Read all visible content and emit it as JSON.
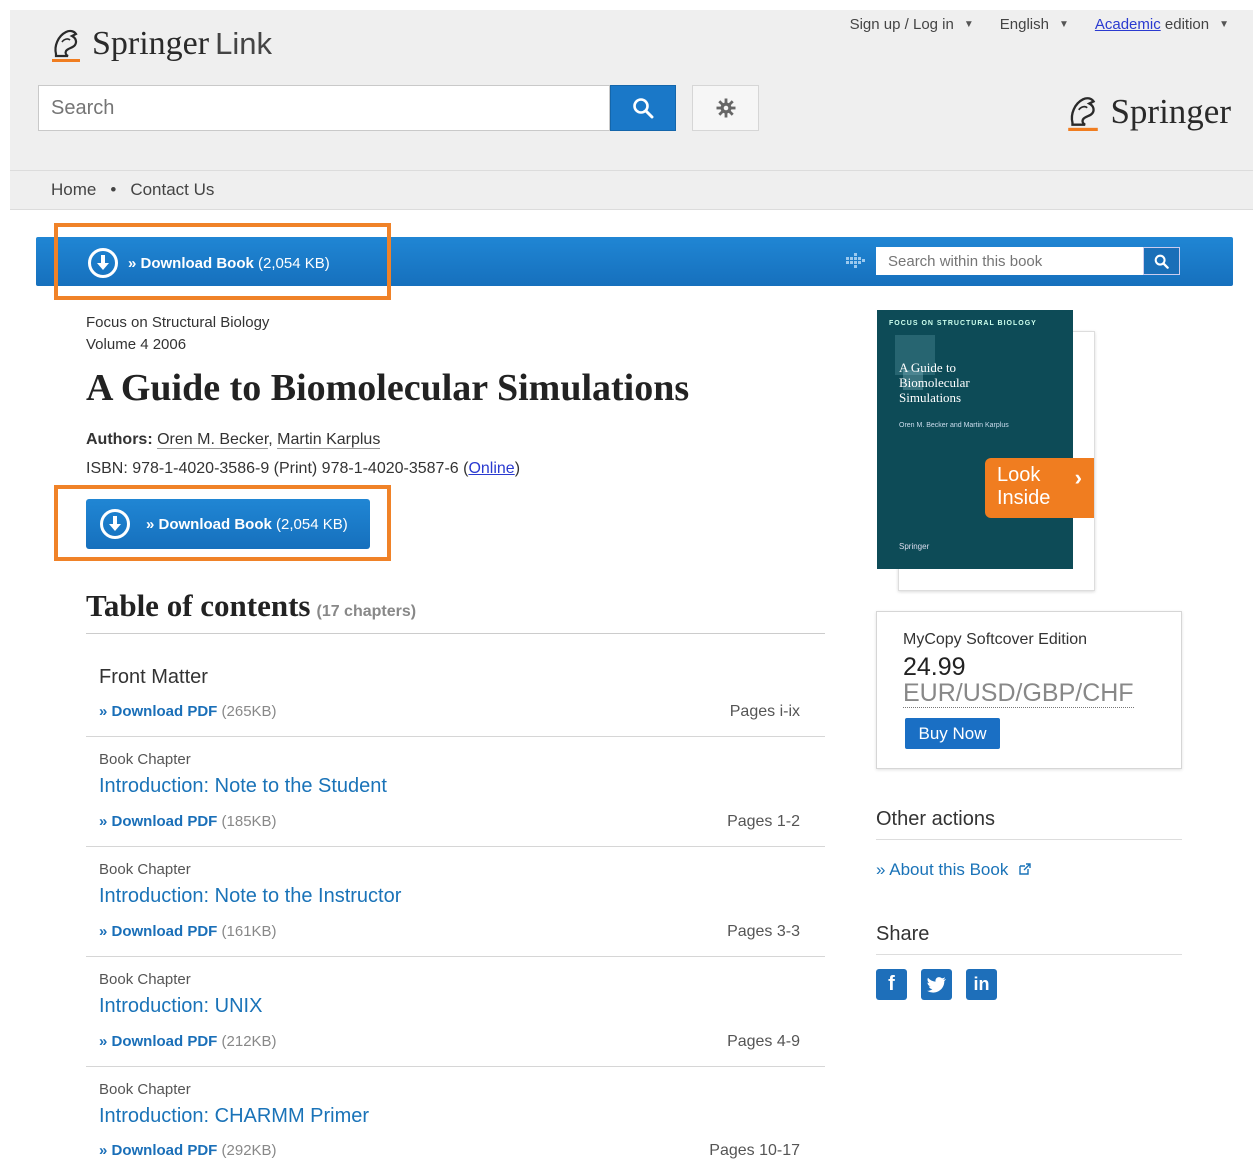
{
  "header": {
    "logo_bold": "Springer",
    "logo_light": "Link",
    "signup": "Sign up / Log in",
    "language": "English",
    "edition_link": "Academic",
    "edition_rest": "edition",
    "search_placeholder": "Search",
    "publisher_logo": "Springer"
  },
  "nav": {
    "home": "Home",
    "sep": "•",
    "contact": "Contact Us"
  },
  "bar": {
    "download_label": "» Download Book",
    "download_size": "(2,054 KB)",
    "search_within_placeholder": "Search within this book"
  },
  "book": {
    "series": "Focus on Structural Biology",
    "volume": "Volume 4 2006",
    "title": "A Guide to Biomolecular Simulations",
    "authors_label": "Authors:",
    "author1": "Oren M. Becker",
    "author_sep": ",",
    "author2": "Martin Karplus",
    "isbn_text": "ISBN: 978-1-4020-3586-9 (Print) 978-1-4020-3587-6 (",
    "isbn_online": "Online",
    "isbn_close": ")",
    "download_label": "» Download Book",
    "download_size": "(2,054 KB)"
  },
  "toc": {
    "heading": "Table of contents",
    "count": "(17 chapters)",
    "pdf_label": "» Download PDF",
    "rows": [
      {
        "kind": "",
        "name": "Front Matter",
        "size": "(265KB)",
        "pages": "Pages i-ix"
      },
      {
        "kind": "Book Chapter",
        "name": "Introduction: Note to the Student",
        "size": "(185KB)",
        "pages": "Pages 1-2"
      },
      {
        "kind": "Book Chapter",
        "name": "Introduction: Note to the Instructor",
        "size": "(161KB)",
        "pages": "Pages 3-3"
      },
      {
        "kind": "Book Chapter",
        "name": "Introduction: UNIX",
        "size": "(212KB)",
        "pages": "Pages 4-9"
      },
      {
        "kind": "Book Chapter",
        "name": "Introduction: CHARMM Primer",
        "size": "(292KB)",
        "pages": "Pages 10-17"
      }
    ]
  },
  "cover": {
    "series": "FOCUS ON STRUCTURAL BIOLOGY",
    "title_l1": "A Guide to",
    "title_l2": "Biomolecular",
    "title_l3": "Simulations",
    "authors": "Oren M. Becker and Martin Karplus",
    "publisher": "Springer",
    "look_l1": "Look",
    "look_l2": "Inside"
  },
  "mycopy": {
    "label": "MyCopy Softcover Edition",
    "price": "24.99",
    "currency": "EUR/USD/GBP/CHF",
    "buy": "Buy Now"
  },
  "sidebar": {
    "other_actions": "Other actions",
    "about": "» About this Book",
    "share": "Share"
  },
  "colors": {
    "primary_blue": "#1a77c6",
    "highlight_orange": "#f08228",
    "link_blue": "#1a73b8"
  },
  "icons": [
    "springer-horse-icon",
    "search-icon",
    "gear-icon",
    "download-icon",
    "facebook-icon",
    "twitter-icon",
    "linkedin-icon",
    "external-link-icon"
  ]
}
